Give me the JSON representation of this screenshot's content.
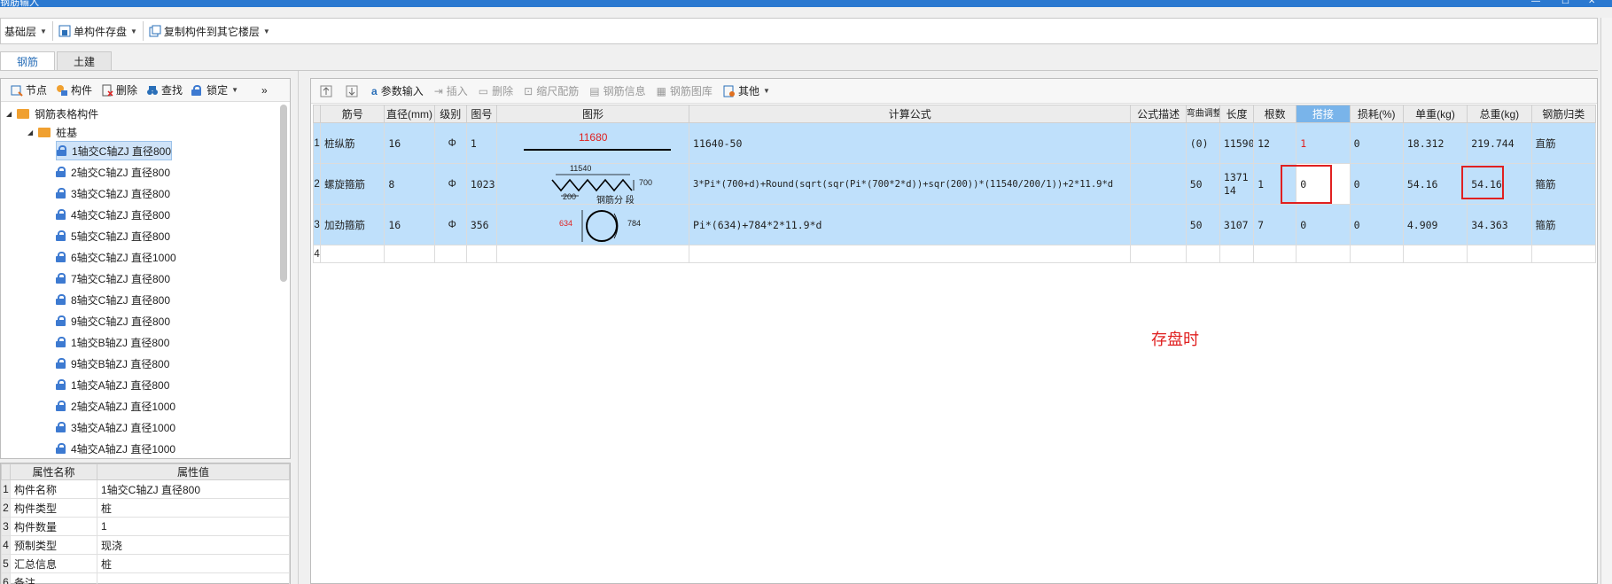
{
  "window": {
    "title": "钢筋输入"
  },
  "toolbar": {
    "floor": "基础层",
    "save_component": "单构件存盘",
    "copy_to_floor": "复制构件到其它楼层"
  },
  "tabs": [
    {
      "label": "钢筋"
    },
    {
      "label": "土建"
    }
  ],
  "left_toolbar": {
    "node": "节点",
    "component": "构件",
    "delete": "删除",
    "find": "查找",
    "lock": "锁定",
    "more": "»"
  },
  "tree": {
    "root": "钢筋表格构件",
    "group": "桩基",
    "items": [
      "1轴交C轴ZJ 直径800",
      "2轴交C轴ZJ 直径800",
      "3轴交C轴ZJ 直径800",
      "4轴交C轴ZJ 直径800",
      "5轴交C轴ZJ 直径800",
      "6轴交C轴ZJ 直径1000",
      "7轴交C轴ZJ 直径800",
      "8轴交C轴ZJ 直径800",
      "9轴交C轴ZJ 直径800",
      "1轴交B轴ZJ 直径800",
      "9轴交B轴ZJ 直径800",
      "1轴交A轴ZJ 直径800",
      "2轴交A轴ZJ 直径1000",
      "3轴交A轴ZJ 直径1000",
      "4轴交A轴ZJ 直径1000"
    ]
  },
  "props": {
    "headers": [
      "属性名称",
      "属性值"
    ],
    "rows": [
      {
        "n": "1",
        "name": "构件名称",
        "value": "1轴交C轴ZJ 直径800"
      },
      {
        "n": "2",
        "name": "构件类型",
        "value": "桩"
      },
      {
        "n": "3",
        "name": "构件数量",
        "value": "1"
      },
      {
        "n": "4",
        "name": "预制类型",
        "value": "现浇"
      },
      {
        "n": "5",
        "name": "汇总信息",
        "value": "桩"
      },
      {
        "n": "6",
        "name": "备注",
        "value": ""
      }
    ]
  },
  "main_toolbar": {
    "param_input": "参数输入",
    "insert": "插入",
    "delete": "删除",
    "scale_rebar": "缩尺配筋",
    "rebar_info": "钢筋信息",
    "rebar_library": "钢筋图库",
    "other": "其他"
  },
  "grid": {
    "headers": [
      "筋号",
      "直径(mm)",
      "级别",
      "图号",
      "图形",
      "计算公式",
      "公式描述",
      "弯曲调整",
      "长度",
      "根数",
      "搭接",
      "损耗(%)",
      "单重(kg)",
      "总重(kg)",
      "钢筋归类"
    ],
    "rows": [
      {
        "n": "1",
        "name": "桩纵筋",
        "dia": "16",
        "grade": "Φ",
        "fig": "1",
        "shape_label": "11680",
        "formula": "11640-50",
        "desc": "",
        "bend": "(0)",
        "length": "11590",
        "count": "12",
        "lap": "1",
        "loss": "0",
        "unit_w": "18.312",
        "total_w": "219.744",
        "category": "直筋"
      },
      {
        "n": "2",
        "name": "螺旋箍筋",
        "dia": "8",
        "grade": "Φ",
        "fig": "1023",
        "shape_top": "11540",
        "shape_h": "700",
        "shape_pitch": "200",
        "shape_note": "钢筋分 段",
        "formula": "3*Pi*(700+d)+Round(sqrt(sqr(Pi*(700*2*d))+sqr(200))*(11540/200/1))+2*11.9*d",
        "desc": "",
        "bend": "50",
        "length": "137114",
        "count": "1",
        "lap": "0",
        "loss": "0",
        "unit_w": "54.16",
        "total_w": "54.16",
        "category": "箍筋"
      },
      {
        "n": "3",
        "name": "加劲箍筋",
        "dia": "16",
        "grade": "Φ",
        "fig": "356",
        "shape_left": "634",
        "shape_right": "784",
        "formula": "Pi*(634)+784*2*11.9*d",
        "desc": "",
        "bend": "50",
        "length": "3107",
        "count": "7",
        "lap": "0",
        "loss": "0",
        "unit_w": "4.909",
        "total_w": "34.363",
        "category": "箍筋"
      },
      {
        "n": "4"
      }
    ]
  },
  "annotation": "存盘时",
  "colors": {
    "selected_row": "#bfe0fb",
    "highlight_header": "#79b4ea",
    "red": "#e02020",
    "title_bar": "#2b79d0"
  }
}
